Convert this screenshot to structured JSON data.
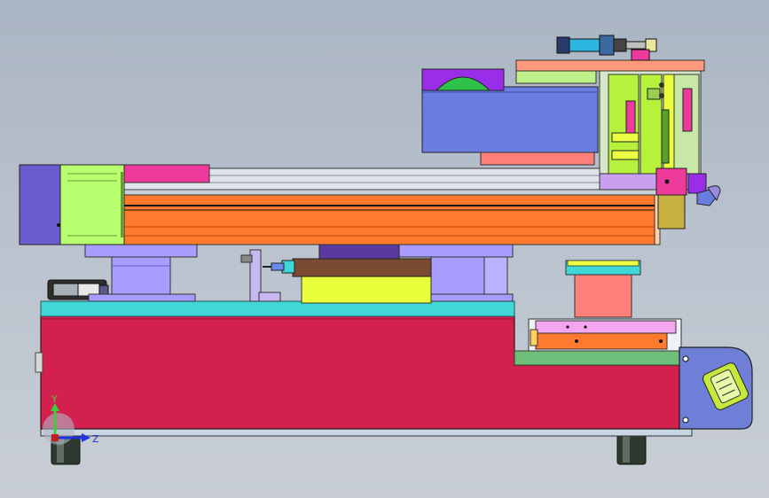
{
  "viewport": {
    "background_top": "#aab5c3",
    "background_bottom": "#c9ced6"
  },
  "triad": {
    "y_label": "Y",
    "z_label": "Z",
    "y_color": "#3ccf3c",
    "z_color": "#2233dd"
  },
  "colors": {
    "base_body": "#d4204e",
    "base_top_plate": "#3fd7d7",
    "motor_block": "#6a5ccf",
    "motor_flange": "#b8ff70",
    "rail_orange": "#ff7a2c",
    "rail_magenta": "#ee3a9a",
    "carriage_lavender": "#a99cff",
    "bracket_yellow": "#eaff3c",
    "brown_block": "#7a4a32",
    "slate_blue_box": "#6a7ee0",
    "salmon": "#ff7f7a",
    "gripper_green": "#b6f23c",
    "end_cap_blue": "#6f7fd8",
    "foot_dark": "#2e3a30"
  }
}
